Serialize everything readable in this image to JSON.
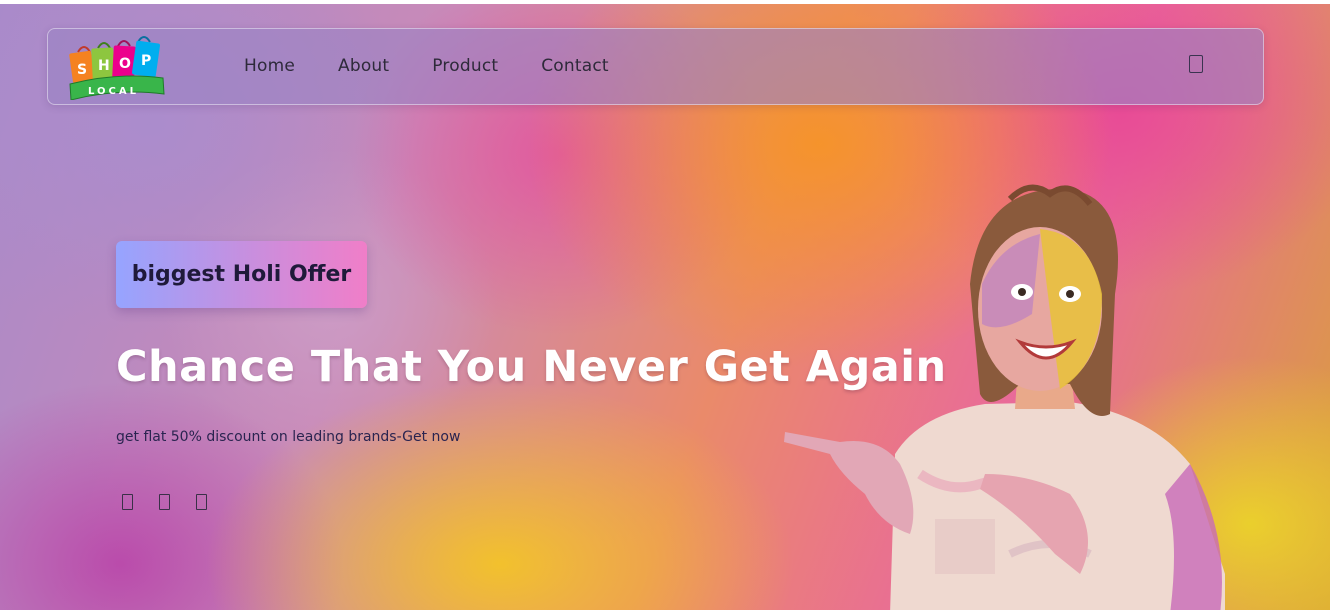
{
  "brand": {
    "logo_letters": [
      "S",
      "H",
      "O",
      "P"
    ],
    "logo_sub": "LOCAL",
    "bag_colors": [
      "#f58220",
      "#8dc63f",
      "#ec008c",
      "#00aeef"
    ],
    "ribbon_color": "#39b54a"
  },
  "nav": {
    "items": [
      {
        "label": "Home"
      },
      {
        "label": "About"
      },
      {
        "label": "Product"
      },
      {
        "label": "Contact"
      }
    ],
    "cart_icon": "shopping-bag-icon"
  },
  "hero": {
    "badge": "biggest Holi Offer",
    "headline": "Chance That You Never Get Again",
    "subtext": "get flat 50% discount on leading brands-Get now",
    "social_icons": [
      "facebook-icon",
      "instagram-icon",
      "twitter-icon"
    ]
  },
  "colors": {
    "badge_gradient_start": "#96a4ff",
    "badge_gradient_end": "#f07ec8",
    "headline": "#ffffff",
    "nav_text": "#2e2a3a"
  }
}
